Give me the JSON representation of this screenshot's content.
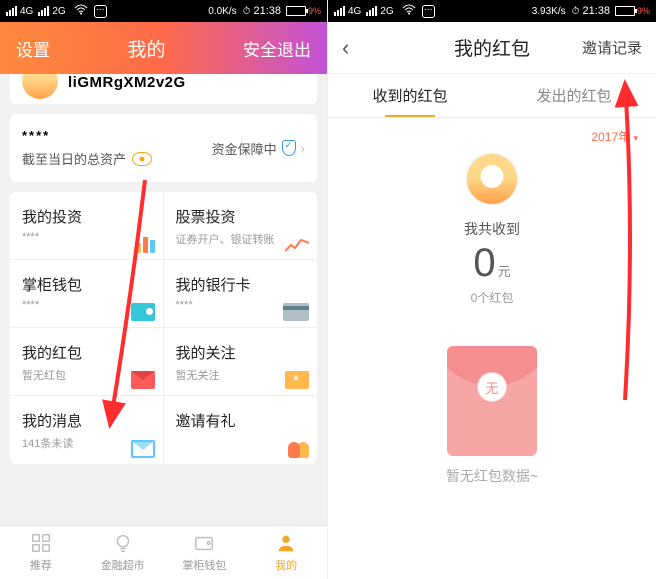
{
  "status": {
    "net1": "4G",
    "net2": "2G",
    "speed_left": "0.0K/s",
    "speed_right": "3.93K/s",
    "time": "21:38",
    "battery_pct": "9%"
  },
  "left": {
    "settings": "设置",
    "title": "我的",
    "logout": "安全退出",
    "username": "liGMRgXM2v2G",
    "asset_stars": "****",
    "asset_label": "截至当日的总资产",
    "asset_guard": "资金保障中",
    "grid": [
      {
        "title": "我的投资",
        "sub": "****"
      },
      {
        "title": "股票投资",
        "sub": "证券开户、银证转账"
      },
      {
        "title": "掌柜钱包",
        "sub": "****"
      },
      {
        "title": "我的银行卡",
        "sub": "****"
      },
      {
        "title": "我的红包",
        "sub": "暂无红包"
      },
      {
        "title": "我的关注",
        "sub": "暂无关注"
      },
      {
        "title": "我的消息",
        "sub": "141条未读"
      },
      {
        "title": "邀请有礼",
        "sub": ""
      }
    ],
    "tabs": [
      "推荐",
      "金融超市",
      "掌柜钱包",
      "我的"
    ]
  },
  "right": {
    "title": "我的红包",
    "action": "邀请记录",
    "seg_received": "收到的红包",
    "seg_sent": "发出的红包",
    "year": "2017年",
    "summary_label": "我共收到",
    "amount": "0",
    "unit": "元",
    "count": "0个红包",
    "empty_coin": "无",
    "empty_text": "暂无红包数据~"
  }
}
